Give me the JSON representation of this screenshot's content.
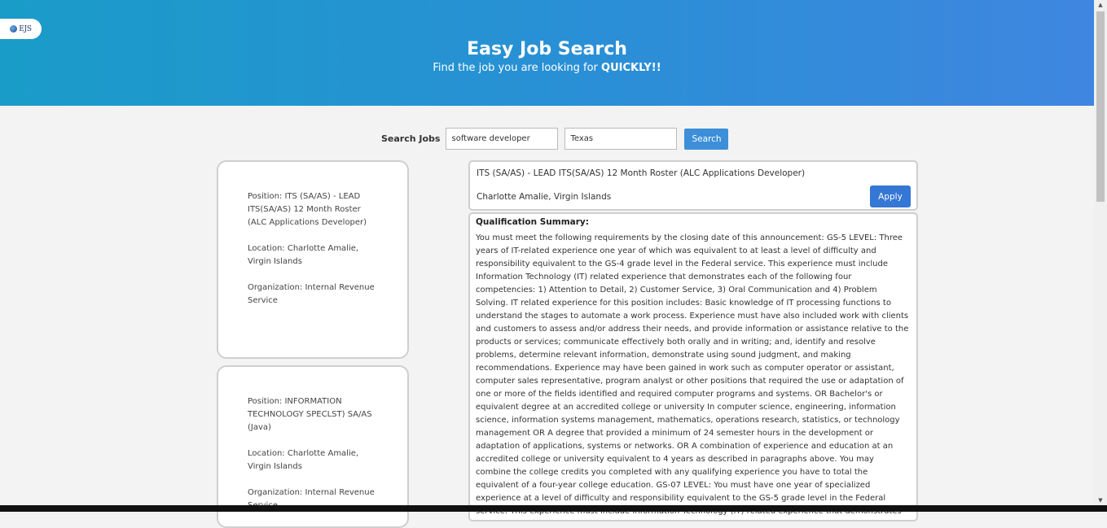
{
  "header": {
    "logo_text": "EJS",
    "title": "Easy Job Search",
    "subtitle_prefix": "Find the job you are looking for ",
    "subtitle_emphasis": "QUICKLY!!"
  },
  "search": {
    "label": "Search Jobs",
    "keyword_value": "software developer",
    "location_value": "Texas",
    "button_label": "Search"
  },
  "results": [
    {
      "position": "Position: ITS (SA/AS) - LEAD ITS(SA/AS) 12 Month Roster (ALC Applications Developer)",
      "location": "Location: Charlotte Amalie, Virgin Islands",
      "organization": "Organization: Internal Revenue Service"
    },
    {
      "position": "Position: INFORMATION TECHNOLOGY SPECLST) SA/AS (Java)",
      "location": "Location: Charlotte Amalie, Virgin Islands",
      "organization": "Organization: Internal Revenue Service"
    }
  ],
  "detail": {
    "title": "ITS (SA/AS) - LEAD ITS(SA/AS) 12 Month Roster (ALC Applications Developer)",
    "location": "Charlotte Amalie, Virgin Islands",
    "apply_label": "Apply",
    "qualification_label": "Qualification Summary:",
    "qualification_text": "You must meet the following requirements by the closing date of this announcement: GS-5 LEVEL: Three years of IT-related experience one year of which was equivalent to at least a level of difficulty and responsibility equivalent to the GS-4 grade level in the Federal service. This experience must include Information Technology (IT) related experience that demonstrates each of the following four competencies: 1) Attention to Detail, 2) Customer Service, 3) Oral Communication and 4) Problem Solving. IT related experience for this position includes: Basic knowledge of IT processing functions to understand the stages to automate a work process. Experience must have also included work with clients and customers to assess and/or address their needs, and provide information or assistance relative to the products or services; communicate effectively both orally and in writing; and, identify and resolve problems, determine relevant information, demonstrate using sound judgment, and making recommendations. Experience may have been gained in work such as computer operator or assistant, computer sales representative, program analyst or other positions that required the use or adaptation of one or more of the fields identified and required computer programs and systems. OR Bachelor's or equivalent degree at an accredited college or university In computer science, engineering, information science, information systems management, mathematics, operations research, statistics, or technology management OR A degree that provided a minimum of 24 semester hours in the development or adaptation of applications, systems or networks. OR A combination of experience and education at an accredited college or university equivalent to 4 years as described in paragraphs above. You may combine the college credits you completed with any qualifying experience you have to total the equivalent of a four-year college education. GS-07 LEVEL: You must have one year of specialized experience at a level of difficulty and responsibility equivalent to the GS-5 grade level in the Federal service: This experience must include Information Technology (IT) related experience that demonstrates each of the following four competencies: 1) Attention to Detail, 2) Customer Service, 3) Oral Communication and"
  },
  "scrollbar": {
    "up_arrow": "▲",
    "down_arrow": "▼"
  }
}
